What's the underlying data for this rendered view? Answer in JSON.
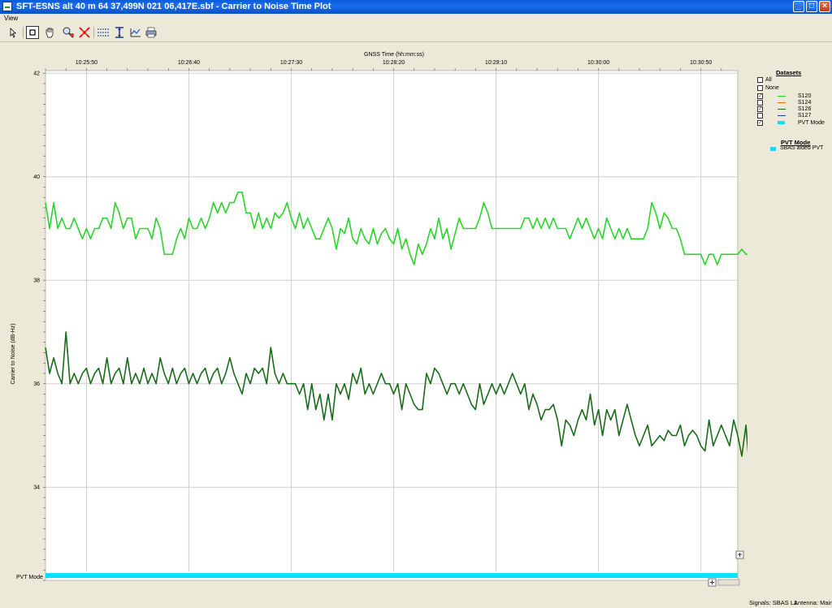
{
  "window": {
    "title": "SFT-ESNS alt 40 m 64 37,499N 021 06,417E.sbf - Carrier to Noise Time Plot",
    "buttons": {
      "minimize": "_",
      "maximize": "□",
      "close": "×"
    }
  },
  "menu": {
    "items": [
      "View"
    ]
  },
  "toolbar": {
    "icons": [
      "cursor-arrow-icon",
      "crop-icon",
      "hand-pan-icon",
      "zoom-magnifier-icon",
      "fit-all-icon",
      "horizontal-lines-icon",
      "vertical-zoom-icon",
      "chart-settings-icon",
      "print-icon"
    ]
  },
  "chart_data": {
    "type": "line",
    "title": "",
    "xlabel": "GNSS Time (hh:mm:ss)",
    "ylabel": "Carrier to Noise (dB-Hz)",
    "ylim": [
      32.2,
      42.05
    ],
    "xlim": [
      "10:25:30",
      "10:31:08"
    ],
    "x_ticks": [
      "10:25:50",
      "10:26:40",
      "10:27:30",
      "10:28:20",
      "10:29:10",
      "10:30:00",
      "10:30:50"
    ],
    "y_ticks": [
      "42",
      "40",
      "38",
      "36",
      "34"
    ],
    "grid": true,
    "pvt_mode_label": "PVT Mode",
    "x_start": "10:25:30",
    "x_step_seconds": 2,
    "series": [
      {
        "name": "S120",
        "color": "#2ad52a",
        "values": [
          39.5,
          39.0,
          39.5,
          39.0,
          39.2,
          39.0,
          39.0,
          39.2,
          39.0,
          38.8,
          39.0,
          38.8,
          39.0,
          39.0,
          39.2,
          39.2,
          39.0,
          39.5,
          39.3,
          39.0,
          39.2,
          39.2,
          38.8,
          39.0,
          39.0,
          39.0,
          38.8,
          39.2,
          39.0,
          38.5,
          38.5,
          38.5,
          38.8,
          39.0,
          38.8,
          39.2,
          39.0,
          39.0,
          39.2,
          39.0,
          39.2,
          39.5,
          39.3,
          39.5,
          39.3,
          39.5,
          39.5,
          39.7,
          39.7,
          39.3,
          39.3,
          39.0,
          39.3,
          39.0,
          39.2,
          39.0,
          39.3,
          39.2,
          39.3,
          39.5,
          39.2,
          39.0,
          39.3,
          39.0,
          39.2,
          39.0,
          38.8,
          38.8,
          39.0,
          39.2,
          39.0,
          38.6,
          39.0,
          38.9,
          39.2,
          38.8,
          38.7,
          39.0,
          38.8,
          38.7,
          39.0,
          38.7,
          38.9,
          39.0,
          38.8,
          38.7,
          39.0,
          38.6,
          38.8,
          38.5,
          38.3,
          38.7,
          38.5,
          38.7,
          39.0,
          38.8,
          39.2,
          38.8,
          39.0,
          38.6,
          38.9,
          39.2,
          39.0,
          39.0,
          39.0,
          39.0,
          39.2,
          39.5,
          39.3,
          39.0,
          39.0,
          39.0,
          39.0,
          39.0,
          39.0,
          39.0,
          39.0,
          39.2,
          39.2,
          39.0,
          39.2,
          39.0,
          39.2,
          39.0,
          39.2,
          39.0,
          39.0,
          39.0,
          38.8,
          39.0,
          39.2,
          39.0,
          39.2,
          39.0,
          38.8,
          39.0,
          38.8,
          39.2,
          39.0,
          38.8,
          39.0,
          38.8,
          39.0,
          38.8,
          38.8,
          38.8,
          38.8,
          39.0,
          39.5,
          39.3,
          39.0,
          39.3,
          39.2,
          39.0,
          39.0,
          38.8,
          38.5,
          38.5,
          38.5,
          38.5,
          38.5,
          38.3,
          38.5,
          38.5,
          38.3,
          38.5,
          38.5,
          38.5,
          38.5,
          38.5,
          38.6,
          38.5,
          38.5,
          38.6,
          38.6,
          38.8,
          38.8,
          38.5,
          38.8,
          38.5,
          38.8,
          38.5
        ]
      },
      {
        "name": "S124",
        "color": "#ff6a00",
        "values": []
      },
      {
        "name": "S126",
        "color": "#1a6b1a",
        "values": [
          36.7,
          36.2,
          36.5,
          36.2,
          36.0,
          37.0,
          36.0,
          36.2,
          36.0,
          36.2,
          36.3,
          36.0,
          36.2,
          36.3,
          36.0,
          36.5,
          36.0,
          36.2,
          36.3,
          36.0,
          36.5,
          36.0,
          36.2,
          36.0,
          36.3,
          36.0,
          36.2,
          36.0,
          36.5,
          36.2,
          36.0,
          36.3,
          36.0,
          36.2,
          36.3,
          36.0,
          36.2,
          36.0,
          36.2,
          36.3,
          36.0,
          36.2,
          36.3,
          36.0,
          36.2,
          36.5,
          36.2,
          36.0,
          35.8,
          36.2,
          36.0,
          36.3,
          36.2,
          36.3,
          36.0,
          36.7,
          36.2,
          36.0,
          36.2,
          36.0,
          36.0,
          36.0,
          35.8,
          36.0,
          35.5,
          36.0,
          35.5,
          35.8,
          35.3,
          35.8,
          35.3,
          36.0,
          35.8,
          36.0,
          35.7,
          36.2,
          36.0,
          36.3,
          35.8,
          36.0,
          35.8,
          36.0,
          36.2,
          36.0,
          36.0,
          35.8,
          36.0,
          35.5,
          36.0,
          35.8,
          35.6,
          35.5,
          35.5,
          36.2,
          36.0,
          36.3,
          36.2,
          36.0,
          35.8,
          36.0,
          36.0,
          35.8,
          36.0,
          35.8,
          35.6,
          35.5,
          36.0,
          35.6,
          35.8,
          36.0,
          35.8,
          36.0,
          35.8,
          36.0,
          36.2,
          36.0,
          35.8,
          36.0,
          35.5,
          35.8,
          35.6,
          35.3,
          35.5,
          35.5,
          35.6,
          35.3,
          34.8,
          35.3,
          35.2,
          35.0,
          35.3,
          35.5,
          35.3,
          35.8,
          35.2,
          35.5,
          35.0,
          35.5,
          35.3,
          35.5,
          35.0,
          35.3,
          35.6,
          35.3,
          35.0,
          34.8,
          35.0,
          35.2,
          34.8,
          34.9,
          35.0,
          34.9,
          35.1,
          35.0,
          35.0,
          35.2,
          34.8,
          35.0,
          35.1,
          35.0,
          34.8,
          34.7,
          35.3,
          34.8,
          35.0,
          35.2,
          35.0,
          34.8,
          35.3,
          35.0,
          34.6,
          35.2,
          34.2,
          35.0,
          35.0
        ]
      },
      {
        "name": "S127",
        "color": "#1a3a8a",
        "values": []
      }
    ],
    "pvt_mode_series": {
      "name": "PVT Mode",
      "color": "#00e5ff",
      "mode": "SBAS aided PVT"
    }
  },
  "legend": {
    "datasets_title": "Datasets",
    "items": [
      {
        "label": "All",
        "checked": false,
        "color": ""
      },
      {
        "label": "None",
        "checked": false,
        "color": ""
      },
      {
        "label": "S120",
        "checked": true,
        "color": "#2ad52a"
      },
      {
        "label": "S124",
        "checked": false,
        "color": "#ff6a00"
      },
      {
        "label": "S126",
        "checked": true,
        "color": "#1a6b1a"
      },
      {
        "label": "S127",
        "checked": false,
        "color": "#1a3a8a"
      },
      {
        "label": "PVT Mode",
        "checked": true,
        "color": "#00e5ff"
      }
    ],
    "pvt_title": "PVT Mode",
    "pvt_items": [
      {
        "label": "SBAS aided PVT",
        "color": "#00e5ff"
      }
    ]
  },
  "status": {
    "signals": "Signals: SBAS L1",
    "antenna": "Antenna: Main"
  }
}
